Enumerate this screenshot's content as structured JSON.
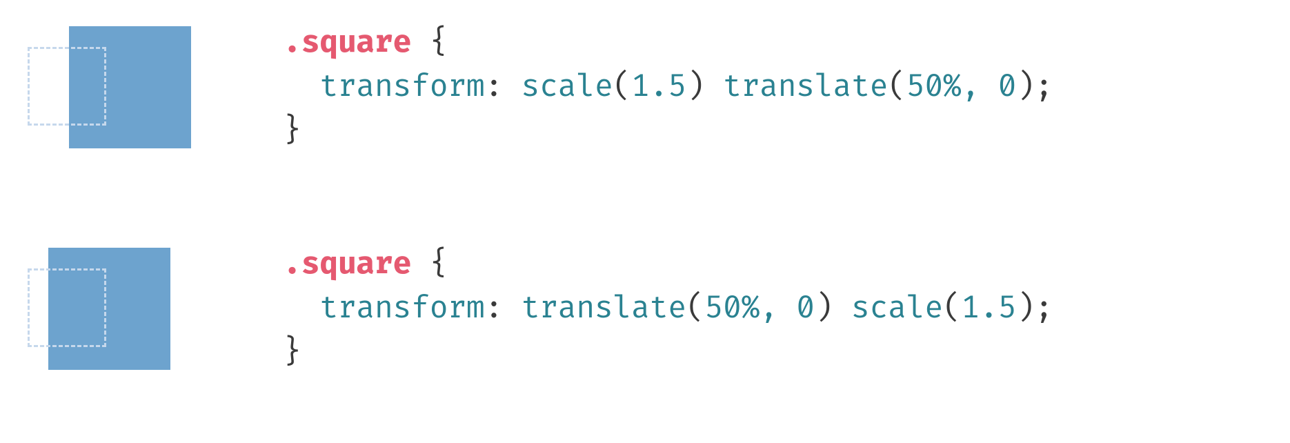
{
  "examples": [
    {
      "selector": ".square",
      "property": "transform",
      "functions": [
        {
          "name": "scale",
          "args": "1.5"
        },
        {
          "name": "translate",
          "args": "50%, 0"
        }
      ]
    },
    {
      "selector": ".square",
      "property": "transform",
      "functions": [
        {
          "name": "translate",
          "args": "50%, 0"
        },
        {
          "name": "scale",
          "args": "1.5"
        }
      ]
    }
  ]
}
